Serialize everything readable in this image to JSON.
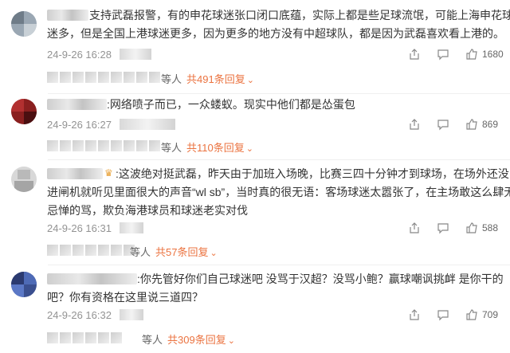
{
  "comments": [
    {
      "text_lines": [
        "支持武磊报警，有的申花球迷张口闭口底蕴，实际上都是些足球流氓，可能上海申花球",
        "迷多，但是全国上港球迷更多，因为更多的地方没有中超球队，都是因为武磊喜欢看上港的。"
      ],
      "date": "24-9-26 16:28",
      "likes": "1680",
      "reply_people": "等人",
      "reply_total": "共491条回复"
    },
    {
      "text_lines": [
        ":网络喷子而已，一众蝼蚁。现实中他们都是怂蛋包"
      ],
      "date": "24-9-26 16:27",
      "likes": "869",
      "reply_people": "等人",
      "reply_total": "共110条回复"
    },
    {
      "text_lines": [
        ":这波绝对挺武磊，昨天由于加班入场晚，比赛三四十分钟才到球场，在场外还没",
        "进闸机就听见里面很大的声音“wl sb”，当时真的很无语：客场球迷太嚣张了，在主场敢这么肆无",
        "忌惮的骂，欺负海港球员和球迷老实对伐"
      ],
      "date": "24-9-26 16:31",
      "likes": "588",
      "reply_people": "等人",
      "reply_total": "共57条回复"
    },
    {
      "text_lines": [
        ":你先管好你们自己球迷吧 没骂于汉超？没骂小鲍？赢球嘲讽挑衅 是你干的",
        "吧？你有资格在这里说三道四？"
      ],
      "date": "24-9-26 16:32",
      "likes": "709",
      "reply_people": "等人",
      "reply_total": "共309条回复"
    }
  ],
  "prefix_first": "支",
  "colors": {
    "accent": "#eb7340",
    "meta": "#939393",
    "text": "#333333"
  },
  "icons": [
    "share-icon",
    "comment-icon",
    "like-icon"
  ]
}
